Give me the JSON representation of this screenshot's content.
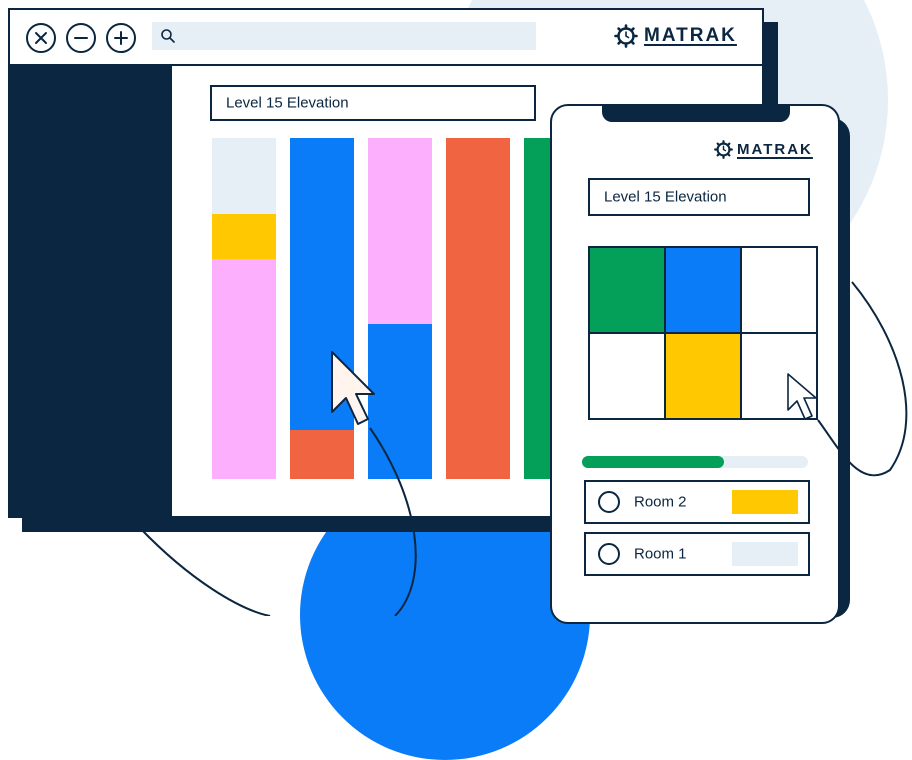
{
  "brand": {
    "name": "MATRAK"
  },
  "window": {
    "controls": [
      "close-icon",
      "minus-icon",
      "plus-icon"
    ],
    "search": {
      "placeholder": "",
      "icon": "search-icon"
    },
    "title_field": "Level 15 Elevation",
    "bars": [
      {
        "segments": [
          {
            "color": "#e6eef6"
          },
          {
            "color": "#ffc800"
          },
          {
            "color": "#fcaffc"
          }
        ]
      },
      {
        "segments": [
          {
            "color": "#0a7cf7"
          },
          {
            "color": "#f06441"
          }
        ]
      },
      {
        "segments": [
          {
            "color": "#fcaffc"
          },
          {
            "color": "#0a7cf7"
          }
        ]
      },
      {
        "segments": [
          {
            "color": "#f06441"
          }
        ]
      },
      {
        "segments": [
          {
            "color": "#04a05a"
          }
        ]
      }
    ]
  },
  "phone": {
    "title_field": "Level 15 Elevation",
    "grid": [
      {
        "color": "#04a05a"
      },
      {
        "color": "#0a7cf7"
      },
      {
        "color": "#ffffff"
      },
      {
        "color": "#ffffff"
      },
      {
        "color": "#ffc800"
      },
      {
        "color": "#ffffff"
      }
    ],
    "progress": 0.63,
    "rooms": [
      {
        "label": "Room 2",
        "color": "#ffc800"
      },
      {
        "label": "Room 1",
        "color": "#e6eef6"
      }
    ]
  },
  "colors": {
    "navy": "#0b2640",
    "blue": "#0a7cf7",
    "green": "#04a05a",
    "orange": "#f06441",
    "pink": "#fcaffc",
    "yellow": "#ffc800",
    "light": "#e6eef6"
  }
}
